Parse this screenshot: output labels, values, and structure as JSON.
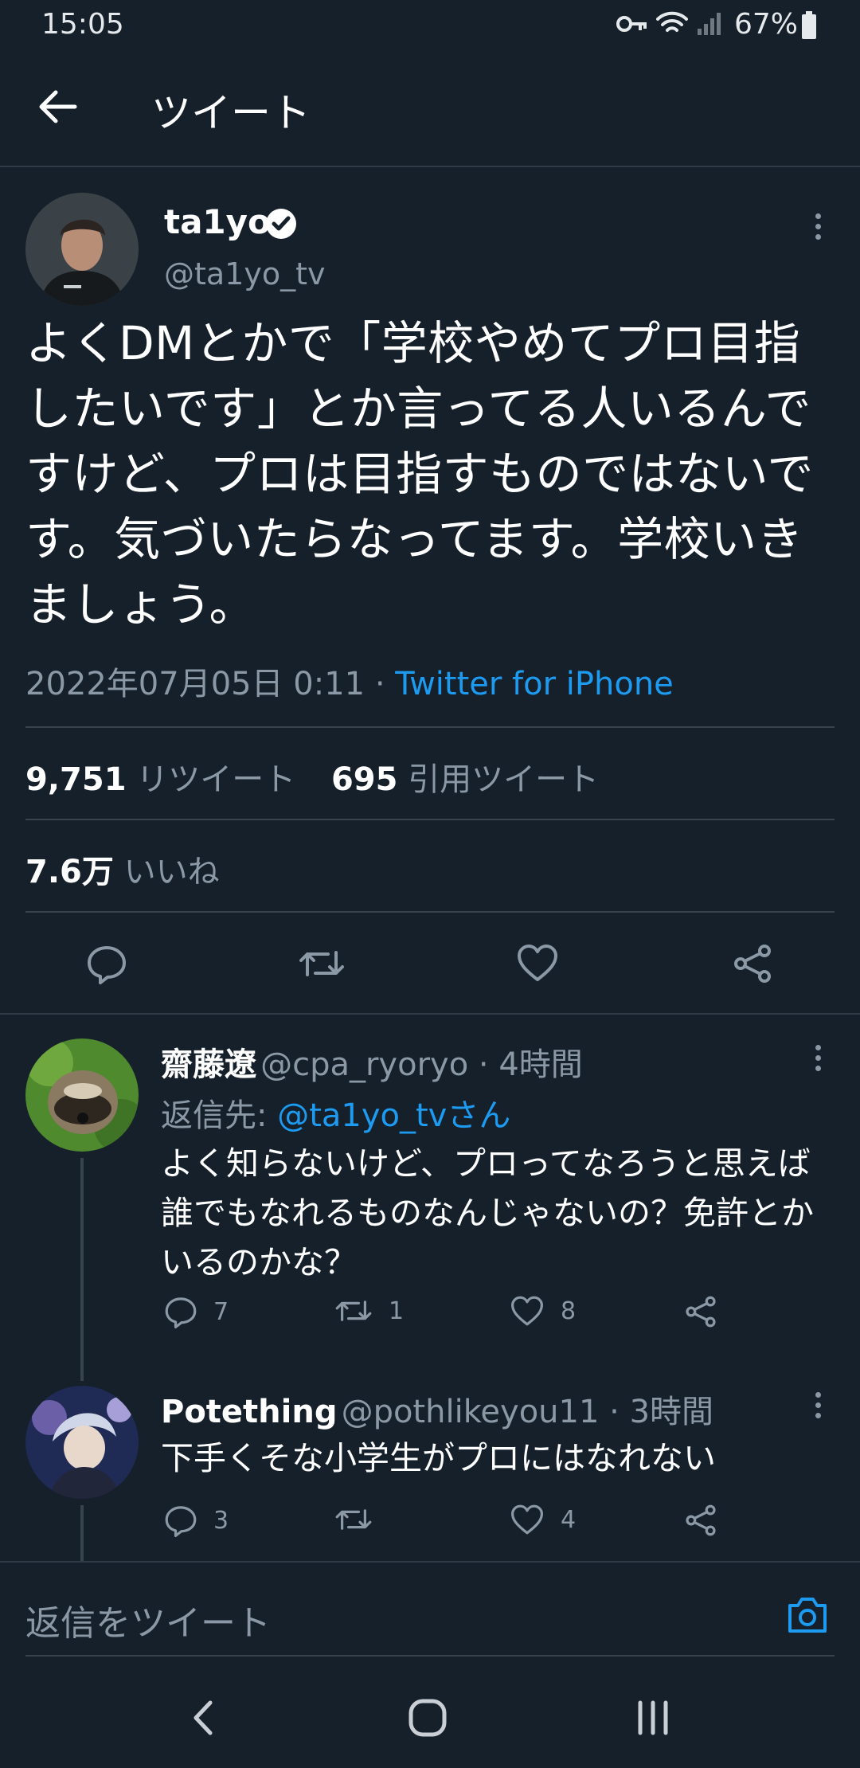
{
  "status_bar": {
    "time": "15:05",
    "battery": "67%"
  },
  "header": {
    "title": "ツイート"
  },
  "tweet": {
    "author_name": "ta1yo",
    "author_handle": "@ta1yo_tv",
    "text": "よくDMとかで「学校やめてプロ目指したいです」とか言ってる人いるんですけど、プロは目指すものではないです。気づいたらなってます。学校いきましょう。",
    "timestamp": "2022年07月05日 0:11 · ",
    "source": "Twitter for iPhone",
    "retweets": "9,751",
    "retweets_label": "リツイート",
    "quotes": "695",
    "quotes_label": "引用ツイート",
    "likes": "7.6万",
    "likes_label": "いいね"
  },
  "replies": [
    {
      "name": "齋藤遼",
      "handle": "@cpa_ryoryo",
      "time": " · 4時間",
      "reply_to_label": "返信先: ",
      "reply_to": "@ta1yo_tvさん",
      "text": "よく知らないけど、プロってなろうと思えば誰でもなれるものなんじゃないの？免許とかいるのかな？",
      "reply_count": "7",
      "retweet_count": "1",
      "like_count": "8"
    },
    {
      "name": "Potething",
      "handle": "@pothlikeyou11",
      "time": " · 3時間",
      "text": "下手くそな小学生がプロにはなれない",
      "reply_count": "3",
      "retweet_count": "",
      "like_count": "4"
    }
  ],
  "composer": {
    "placeholder": "返信をツイート"
  },
  "colors": {
    "background": "#15202b",
    "accent": "#1d9bf0",
    "muted": "#8b98a5"
  }
}
